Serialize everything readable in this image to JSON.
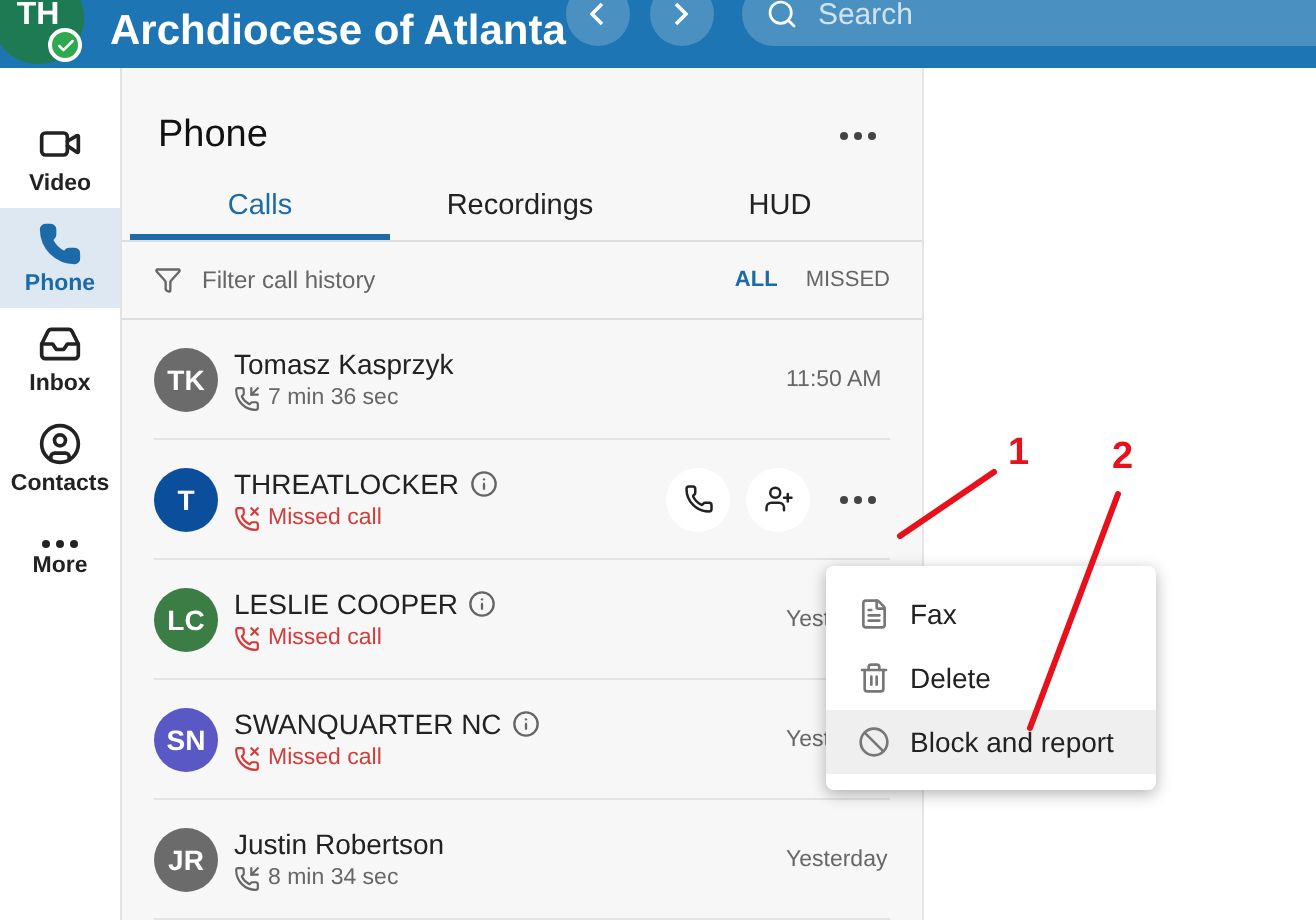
{
  "header": {
    "avatar_initials": "TH",
    "title": "Archdiocese of Atlanta",
    "search": {
      "placeholder": "Search"
    }
  },
  "rail": {
    "items": [
      {
        "label": "Video",
        "selected": false
      },
      {
        "label": "Phone",
        "selected": true
      },
      {
        "label": "Inbox",
        "selected": false
      },
      {
        "label": "Contacts",
        "selected": false
      },
      {
        "label": "More",
        "selected": false
      }
    ]
  },
  "panel": {
    "title": "Phone",
    "tabs": [
      {
        "label": "Calls",
        "selected": true
      },
      {
        "label": "Recordings",
        "selected": false
      },
      {
        "label": "HUD",
        "selected": false
      }
    ],
    "filter": {
      "placeholder": "Filter call history"
    },
    "filters": [
      {
        "label": "ALL",
        "selected": true
      },
      {
        "label": "MISSED",
        "selected": false
      }
    ],
    "calls": [
      {
        "initials": "TK",
        "color": "#6b6b6b",
        "name": "Tomasz Kasprzyk",
        "info": false,
        "kind": "incoming",
        "detail": "7 min 36 sec",
        "time": "11:50 AM",
        "hovered": false
      },
      {
        "initials": "T",
        "color": "#0b4f9c",
        "name": "THREATLOCKER",
        "info": true,
        "kind": "missed",
        "detail": "Missed call",
        "hovered": true
      },
      {
        "initials": "LC",
        "color": "#3b7d44",
        "name": "LESLIE COOPER",
        "info": true,
        "kind": "missed",
        "detail": "Missed call",
        "time": "Yest",
        "hovered": false
      },
      {
        "initials": "SN",
        "color": "#5a58c4",
        "name": "SWANQUARTER NC",
        "info": true,
        "kind": "missed",
        "detail": "Missed call",
        "time": "Yest",
        "hovered": false
      },
      {
        "initials": "JR",
        "color": "#6b6b6b",
        "name": "Justin Robertson",
        "info": false,
        "kind": "incoming",
        "detail": "8 min 34 sec",
        "time": "Yesterday",
        "hovered": false
      }
    ],
    "menu": [
      {
        "label": "Fax",
        "selected": false
      },
      {
        "label": "Delete",
        "selected": false
      },
      {
        "label": "Block and report",
        "selected": true
      }
    ]
  },
  "annotations": [
    {
      "label": "1"
    },
    {
      "label": "2"
    }
  ]
}
